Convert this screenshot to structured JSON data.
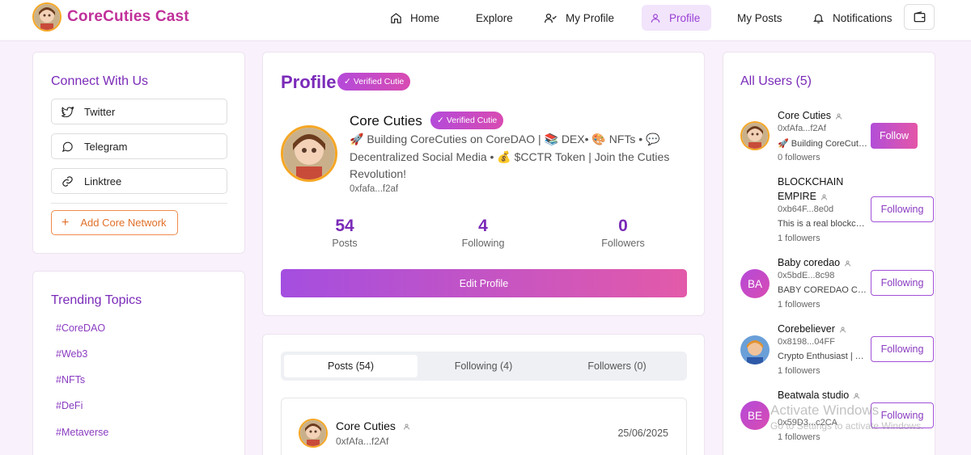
{
  "brand": {
    "name": "CoreCuties Cast"
  },
  "nav": {
    "home": "Home",
    "explore": "Explore",
    "my_profile": "My Profile",
    "profile": "Profile",
    "my_posts": "My Posts",
    "notifications": "Notifications"
  },
  "connect": {
    "title": "Connect With Us",
    "links": [
      "Twitter",
      "Telegram",
      "Linktree"
    ],
    "add_label": "Add Core Network"
  },
  "trending": {
    "title": "Trending Topics",
    "tags": [
      "#CoreDAO",
      "#Web3",
      "#NFTs",
      "#DeFi",
      "#Metaverse"
    ]
  },
  "profile": {
    "heading": "Profile",
    "badge": "Verified Cutie",
    "name": "Core Cuties",
    "bio": "🚀 Building CoreCuties on CoreDAO | 📚 DEX• 🎨 NFTs • 💬 Decentralized Social Media • 💰 $CCTR Token | Join the Cuties Revolution!",
    "address": "0xfafa...f2af",
    "stats": {
      "posts": {
        "value": "54",
        "label": "Posts"
      },
      "following": {
        "value": "4",
        "label": "Following"
      },
      "followers": {
        "value": "0",
        "label": "Followers"
      }
    },
    "edit_label": "Edit Profile"
  },
  "feed": {
    "tabs": [
      "Posts (54)",
      "Following (4)",
      "Followers (0)"
    ],
    "post": {
      "name": "Core Cuties",
      "address": "0xfAfa...f2Af",
      "date": "25/06/2025"
    }
  },
  "users": {
    "title": "All Users (5)",
    "list": [
      {
        "name": "Core Cuties",
        "address": "0xfAfa...f2Af",
        "bio": "🚀 Building CoreCutie...",
        "followers": "0 followers",
        "button": "Follow"
      },
      {
        "name": "BLOCKCHAIN EMPIRE",
        "address": "0xb64F...8e0d",
        "bio": "This is a real blockchai...",
        "followers": "1 followers",
        "button": "Following"
      },
      {
        "name": "Baby coredao",
        "initials": "BA",
        "address": "0x5bdE...8c98",
        "bio": "BABY COREDAO CA : ...",
        "followers": "1 followers",
        "button": "Following"
      },
      {
        "name": "Corebeliever",
        "address": "0x8198...04FF",
        "bio": "Crypto Enthusiast | Tra...",
        "followers": "1 followers",
        "button": "Following"
      },
      {
        "name": "Beatwala studio",
        "initials": "BE",
        "address": "0x59D3...c2CA",
        "bio": "",
        "followers": "1 followers",
        "button": "Following"
      }
    ]
  },
  "watermark": {
    "line1": "Activate Windows",
    "line2": "Go to Settings to activate Windows."
  },
  "colors": {
    "accent": "#7a2ab8",
    "brand": "#c0309a",
    "gradient_start": "#a44ee0",
    "gradient_end": "#e35aa9"
  }
}
